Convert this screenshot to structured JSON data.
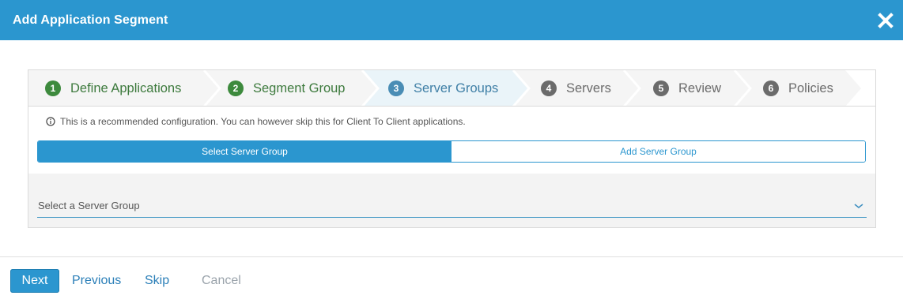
{
  "dialog": {
    "title": "Add Application Segment",
    "header_color": "#2b96cf"
  },
  "wizard": {
    "steps": [
      {
        "number": "1",
        "label": "Define Applications",
        "state": "done"
      },
      {
        "number": "2",
        "label": "Segment Group",
        "state": "done"
      },
      {
        "number": "3",
        "label": "Server Groups",
        "state": "active"
      },
      {
        "number": "4",
        "label": "Servers",
        "state": "pending"
      },
      {
        "number": "5",
        "label": "Review",
        "state": "pending"
      },
      {
        "number": "6",
        "label": "Policies",
        "state": "pending"
      }
    ]
  },
  "info": {
    "icon": "info-icon",
    "text": "This is a recommended configuration. You can however skip this for Client To Client applications."
  },
  "mode_toggle": {
    "options": [
      "Select Server Group",
      "Add Server Group"
    ],
    "selected": "Select Server Group"
  },
  "server_group_select": {
    "placeholder": "Select a Server Group"
  },
  "footer": {
    "next_label": "Next",
    "previous_label": "Previous",
    "skip_label": "Skip",
    "cancel_label": "Cancel"
  }
}
